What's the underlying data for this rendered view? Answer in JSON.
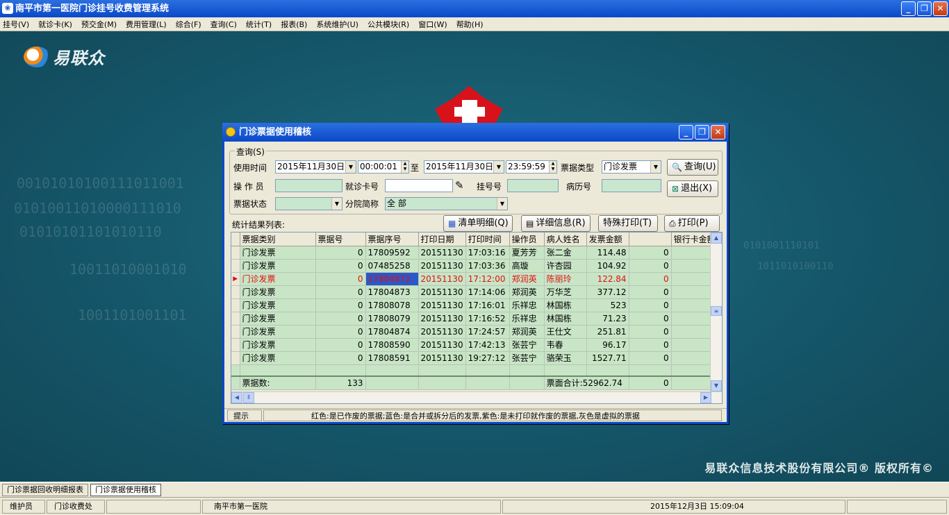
{
  "app": {
    "title": "南平市第一医院门诊挂号收费管理系统",
    "window_buttons": [
      "_",
      "❐",
      "✕"
    ]
  },
  "menu": [
    "挂号(V)",
    "就诊卡(K)",
    "预交金(M)",
    "费用管理(L)",
    "综合(F)",
    "查询(C)",
    "统计(T)",
    "报表(B)",
    "系统维护(U)",
    "公共模块(R)",
    "窗口(W)",
    "帮助(H)"
  ],
  "desktop": {
    "logo_text": "易联众",
    "copyright": "易联众信息技术股份有限公司®  版权所有©"
  },
  "dialog": {
    "title": "门诊票据使用稽核",
    "query_group": "查询(S)",
    "use_time_label": "使用时间",
    "date_from": "2015年11月30日",
    "time_from": "00:00:01",
    "to_label": "至",
    "date_to": "2015年11月30日",
    "time_to": "23:59:59",
    "bill_type_label": "票据类型",
    "bill_type_value": "门诊发票",
    "query_button": "查询(U)",
    "exit_button": "退出(X)",
    "operator_label": "操 作 员",
    "card_label": "就诊卡号",
    "reg_label": "挂号号",
    "record_label": "病历号",
    "status_label": "票据状态",
    "branch_label": "分院简称",
    "branch_value": "全 部",
    "results_label": "统计结果列表:",
    "list_detail_button": "清单明细(Q)",
    "detail_info_button": "详细信息(R)",
    "special_print_button": "特殊打印(T)",
    "print_button": "打印(P)",
    "columns": [
      "票据类别",
      "票据号",
      "票据序号",
      "打印日期",
      "打印时间",
      "操作员",
      "病人姓名",
      "发票金额",
      "",
      "银行卡金额"
    ],
    "rows": [
      [
        "门诊发票",
        "0",
        "17809592",
        "20151130",
        "17:03:16",
        "夏芳芳",
        "张二金",
        "114.48",
        "0",
        ""
      ],
      [
        "门诊发票",
        "0",
        "07485258",
        "20151130",
        "17:03:36",
        "高璇",
        "许杏园",
        "104.92",
        "0",
        ""
      ],
      [
        "门诊发票",
        "0",
        "17804872",
        "20151130",
        "17:12:00",
        "郑润英",
        "陈丽玲",
        "122.84",
        "0",
        ""
      ],
      [
        "门诊发票",
        "0",
        "17804873",
        "20151130",
        "17:14:06",
        "郑润英",
        "万华芝",
        "377.12",
        "0",
        ""
      ],
      [
        "门诊发票",
        "0",
        "17808078",
        "20151130",
        "17:16:01",
        "乐祥忠",
        "林国栋",
        "523",
        "0",
        ""
      ],
      [
        "门诊发票",
        "0",
        "17808079",
        "20151130",
        "17:16:52",
        "乐祥忠",
        "林国栋",
        "71.23",
        "0",
        ""
      ],
      [
        "门诊发票",
        "0",
        "17804874",
        "20151130",
        "17:24:57",
        "郑润英",
        "王仕文",
        "251.81",
        "0",
        ""
      ],
      [
        "门诊发票",
        "0",
        "17808590",
        "20151130",
        "17:42:13",
        "张芸宁",
        "韦春",
        "96.17",
        "0",
        ""
      ],
      [
        "门诊发票",
        "0",
        "17808591",
        "20151130",
        "19:27:12",
        "张芸宁",
        "骆荣玉",
        "1527.71",
        "0",
        ""
      ]
    ],
    "footer": {
      "count_label": "票据数:",
      "count_value": "133",
      "total_label": "票面合计:52962.74",
      "total_extra": "0"
    },
    "status_hint": "提示",
    "status_text": "红色:是已作废的票据;蓝色:是合并或拆分后的发票,紫色:是未打印就作废的票据,灰色是虚拟的票据"
  },
  "tasks": [
    "门诊票据回收明细报表",
    "门诊票据使用稽核"
  ],
  "statusbar": {
    "user": "维护员",
    "dept": "门诊收费处",
    "hospital": "南平市第一医院",
    "datetime": "2015年12月3日 15:09:04"
  },
  "colors": {
    "desktop": "#15566a",
    "titlebar": "#0a49c8",
    "grid_row": "#c8e5c6",
    "void_text": "#e01010"
  }
}
